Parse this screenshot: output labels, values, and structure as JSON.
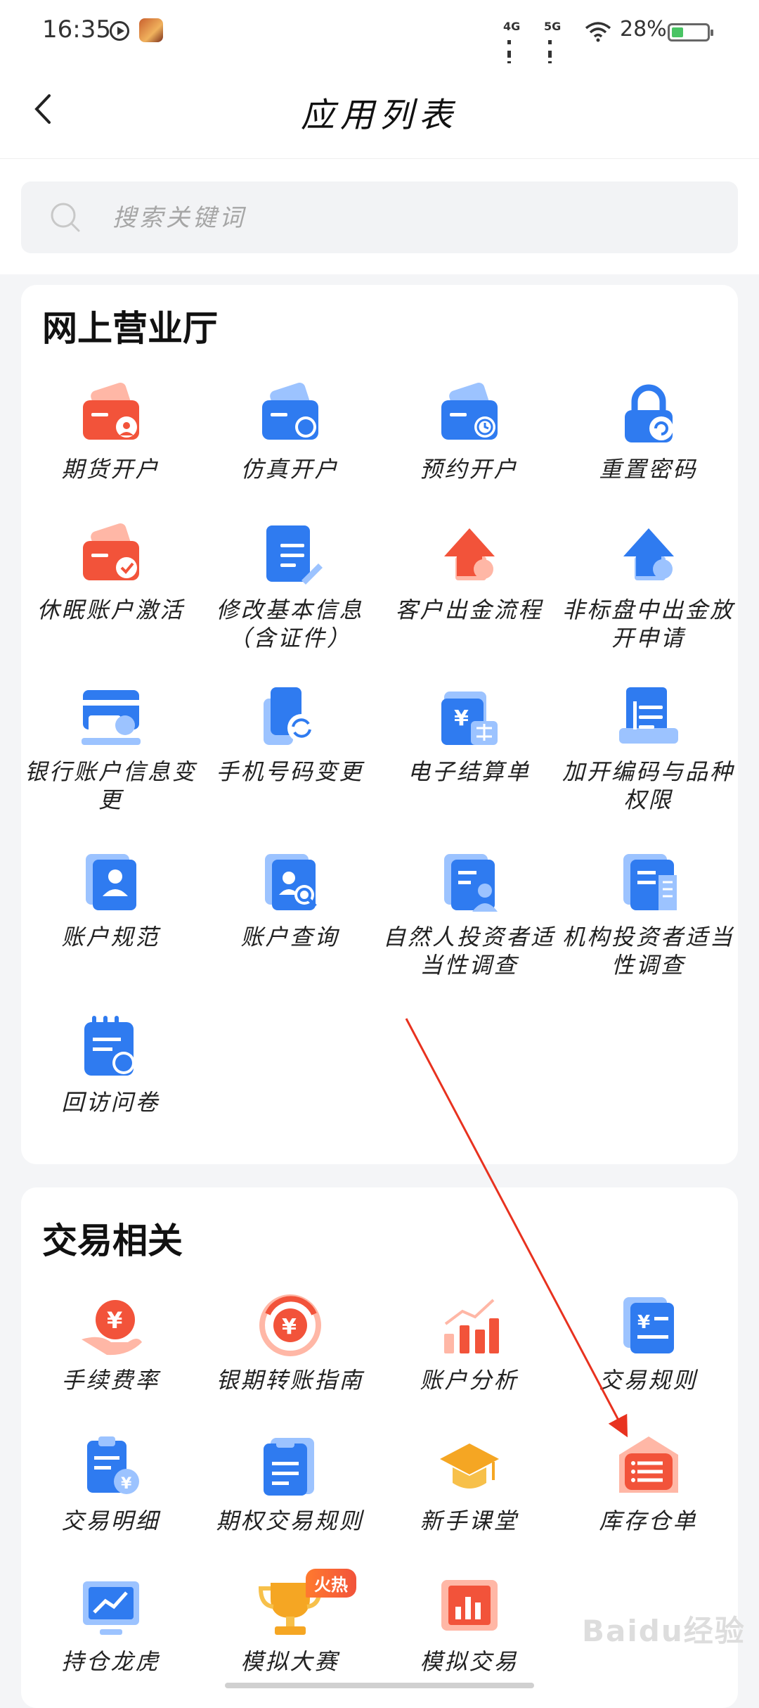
{
  "status_bar": {
    "time": "16:35",
    "signal1": "4G",
    "signal2": "5G",
    "battery": "28%"
  },
  "nav": {
    "title": "应用列表"
  },
  "search": {
    "placeholder": "搜索关键词"
  },
  "sections": [
    {
      "title": "网上营业厅",
      "items": [
        {
          "label": "期货开户",
          "icon": "futures-account-icon"
        },
        {
          "label": "仿真开户",
          "icon": "simulation-account-icon"
        },
        {
          "label": "预约开户",
          "icon": "appointment-account-icon"
        },
        {
          "label": "重置密码",
          "icon": "reset-password-icon"
        },
        {
          "label": "休眠账户激活",
          "icon": "dormant-account-icon"
        },
        {
          "label": "修改基本信息（含证件）",
          "icon": "edit-info-icon"
        },
        {
          "label": "客户出金流程",
          "icon": "withdraw-flow-icon"
        },
        {
          "label": "非标盘中出金放开申请",
          "icon": "nonstandard-withdraw-icon"
        },
        {
          "label": "银行账户信息变更",
          "icon": "bank-account-icon"
        },
        {
          "label": "手机号码变更",
          "icon": "phone-change-icon"
        },
        {
          "label": "电子结算单",
          "icon": "settlement-icon"
        },
        {
          "label": "加开编码与品种权限",
          "icon": "code-permission-icon"
        },
        {
          "label": "账户规范",
          "icon": "account-norm-icon"
        },
        {
          "label": "账户查询",
          "icon": "account-query-icon"
        },
        {
          "label": "自然人投资者适当性调查",
          "icon": "individual-survey-icon"
        },
        {
          "label": "机构投资者适当性调查",
          "icon": "institution-survey-icon"
        },
        {
          "label": "回访问卷",
          "icon": "revisit-survey-icon"
        }
      ]
    },
    {
      "title": "交易相关",
      "items": [
        {
          "label": "手续费率",
          "icon": "fee-rate-icon"
        },
        {
          "label": "银期转账指南",
          "icon": "bank-transfer-icon"
        },
        {
          "label": "账户分析",
          "icon": "account-analysis-icon"
        },
        {
          "label": "交易规则",
          "icon": "trade-rules-icon"
        },
        {
          "label": "交易明细",
          "icon": "trade-details-icon"
        },
        {
          "label": "期权交易规则",
          "icon": "option-rules-icon"
        },
        {
          "label": "新手课堂",
          "icon": "newbie-class-icon"
        },
        {
          "label": "库存仓单",
          "icon": "warehouse-receipt-icon"
        },
        {
          "label": "持仓龙虎",
          "icon": "position-ranking-icon"
        },
        {
          "label": "模拟大赛",
          "icon": "contest-icon",
          "badge": "火热"
        },
        {
          "label": "模拟交易",
          "icon": "sim-trading-icon"
        }
      ]
    }
  ],
  "watermark": "Baidu经验",
  "colors": {
    "blue": "#2f7bf0",
    "red": "#f2533a",
    "orange": "#f5a623",
    "annotation": "#e8321f"
  }
}
